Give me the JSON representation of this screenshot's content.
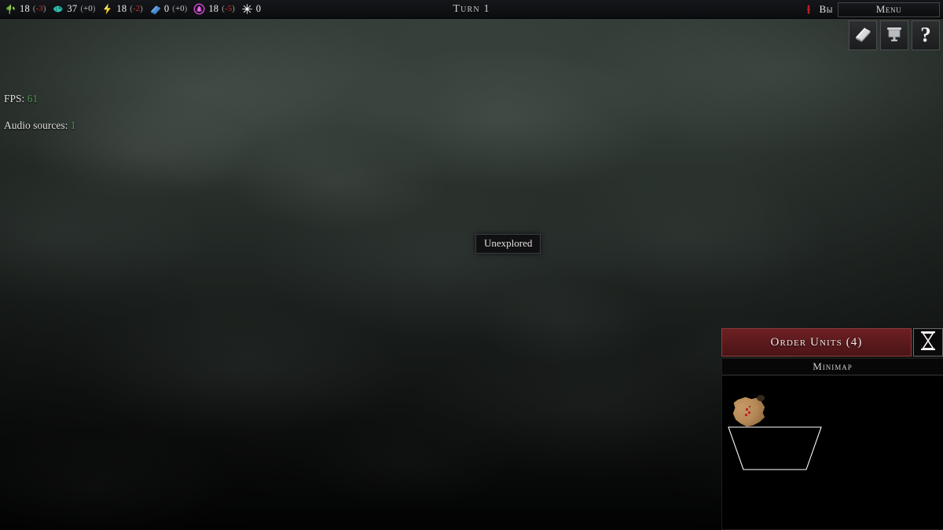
{
  "topbar": {
    "resources": [
      {
        "icon": "leaf-icon",
        "name": "food",
        "value": "18",
        "delta": "-3",
        "delta_sign": "neg",
        "color": "#7fbf3f"
      },
      {
        "icon": "fish-icon",
        "name": "production",
        "value": "37",
        "delta": "+0",
        "delta_sign": "zero",
        "color": "#2fbfae"
      },
      {
        "icon": "lightning-icon",
        "name": "energy",
        "value": "18",
        "delta": "-2",
        "delta_sign": "neg",
        "color": "#f5d428"
      },
      {
        "icon": "book-icon",
        "name": "research",
        "value": "0",
        "delta": "+0",
        "delta_sign": "zero",
        "color": "#4d8fd6"
      },
      {
        "icon": "portal-icon",
        "name": "influence",
        "value": "18",
        "delta": "-5",
        "delta_sign": "neg",
        "color": "#d84ad8"
      },
      {
        "icon": "burst-icon",
        "name": "unrest",
        "value": "0",
        "delta": "",
        "delta_sign": "none",
        "color": "#e8e8e8"
      }
    ],
    "turn_label": "Turn 1",
    "faction_icon": "faction-emblem-icon",
    "faction_name": "Вы",
    "menu_label": "Menu"
  },
  "iconbar": {
    "buttons": [
      {
        "name": "codex-button",
        "icon": "book-icon",
        "label": ""
      },
      {
        "name": "scroll-button",
        "icon": "scroll-icon",
        "label": ""
      },
      {
        "name": "help-button",
        "icon": "question-mark-icon",
        "label": "?"
      }
    ]
  },
  "debug": {
    "fps_label": "FPS:",
    "fps_value": "61",
    "audio_label": "Audio sources:",
    "audio_value": "1",
    "value_color": "#4c9a4c"
  },
  "tooltip": {
    "text": "Unexplored"
  },
  "panel": {
    "order_units_label": "Order Units (4)",
    "order_units_color": "#5c1a1d",
    "end_turn_icon": "hourglass-icon",
    "minimap_title": "Minimap",
    "minimap": {
      "landmass_color": "#b88a55",
      "viewport_outline_color": "#ffffff",
      "background_color": "#000000"
    }
  }
}
